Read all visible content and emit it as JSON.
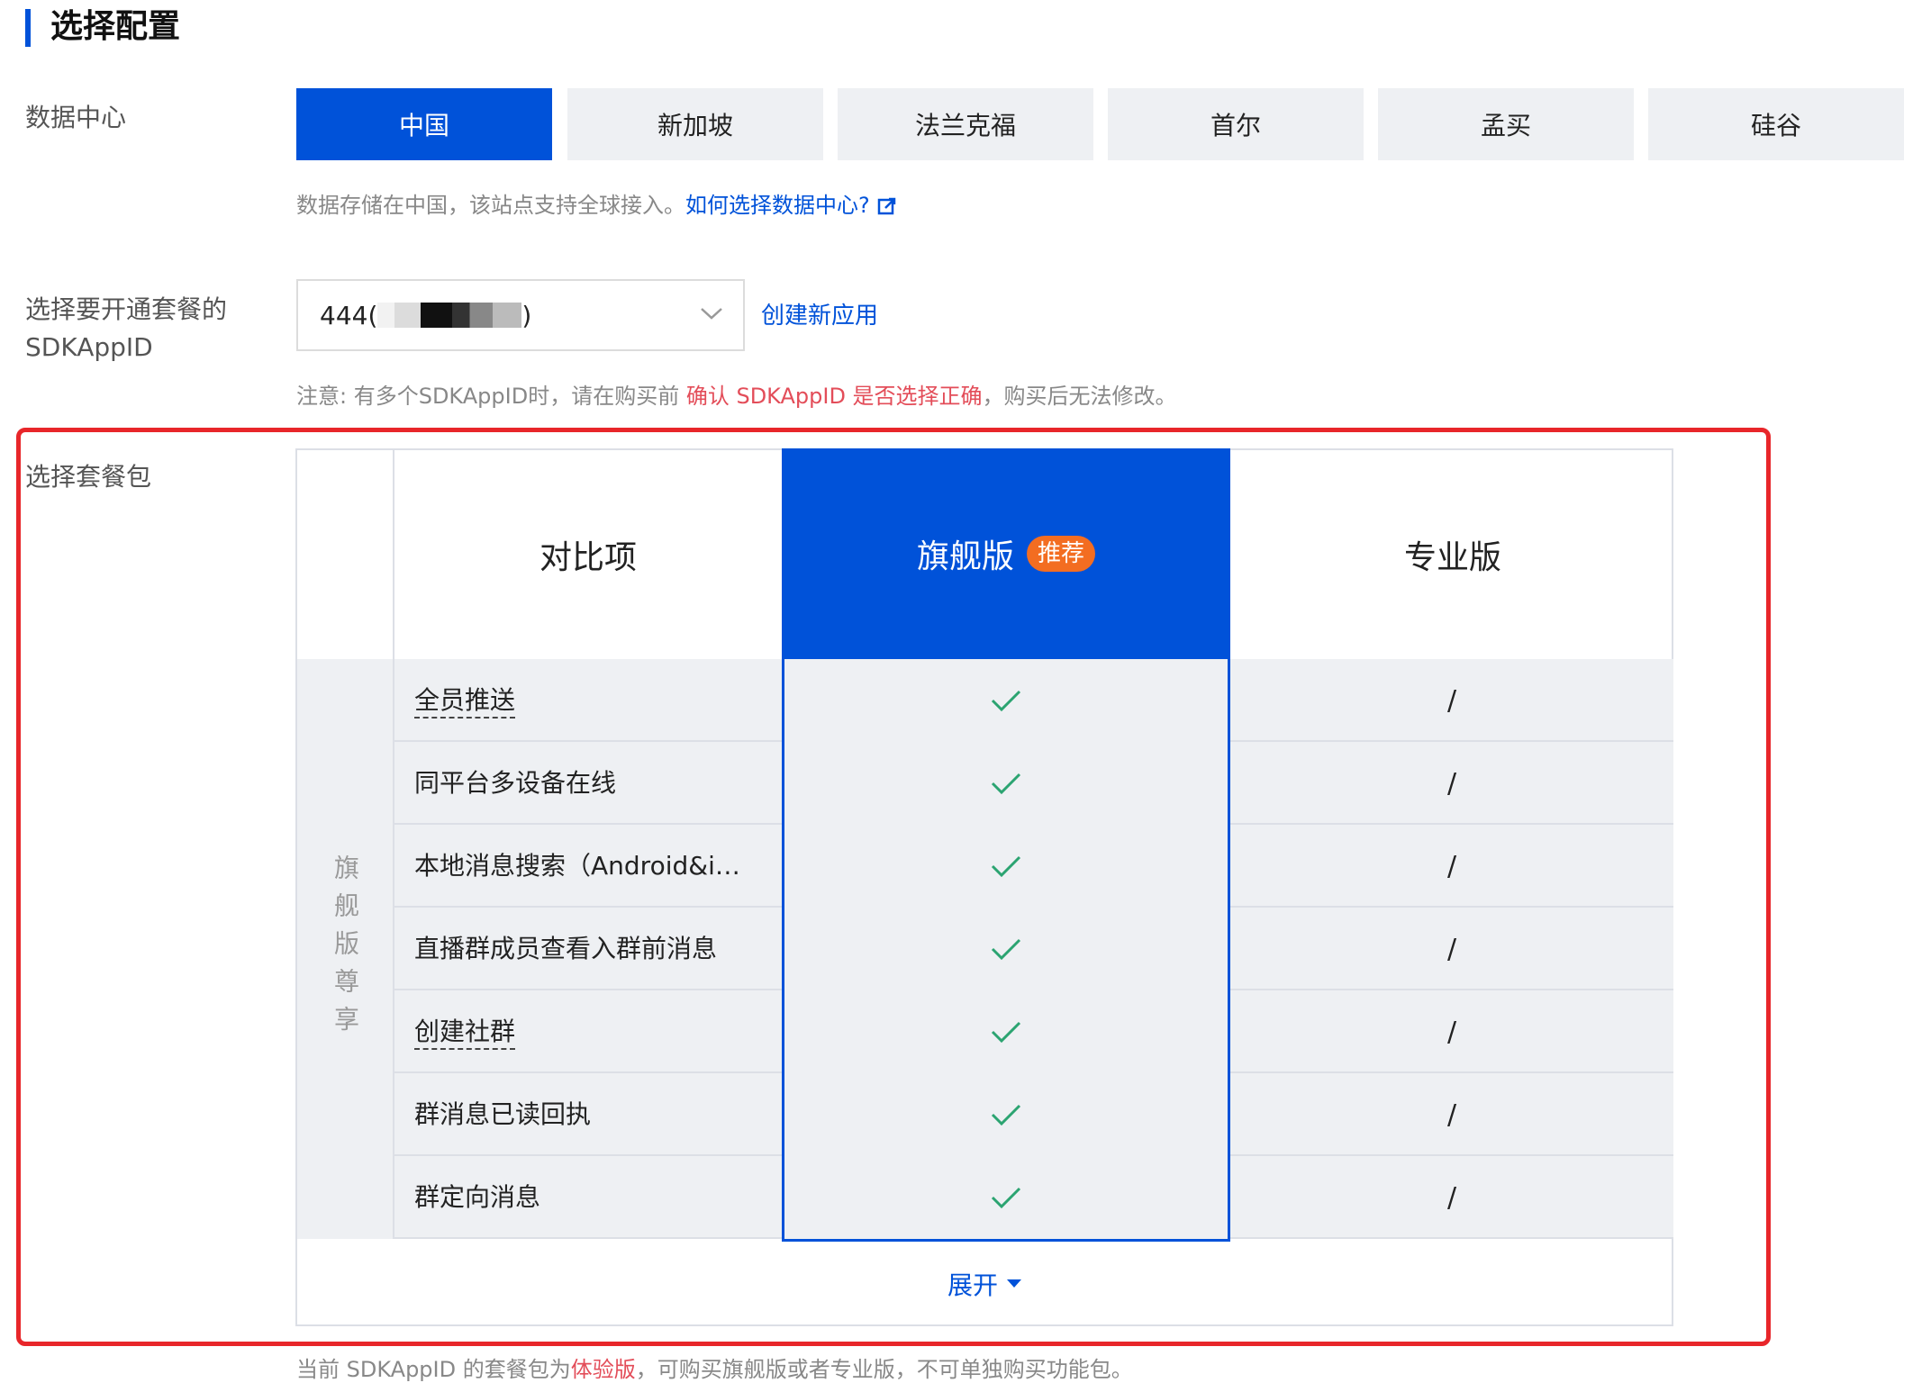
{
  "section": {
    "title": "选择配置"
  },
  "data_center": {
    "label": "数据中心",
    "options": [
      "中国",
      "新加坡",
      "法兰克福",
      "首尔",
      "孟买",
      "硅谷"
    ],
    "selected": "中国",
    "hint_text": "数据存储在中国，该站点支持全球接入。",
    "hint_link": "如何选择数据中心?"
  },
  "sdkappid": {
    "label_line1": "选择要开通套餐的",
    "label_line2": "SDKAppID",
    "value_prefix": "444(",
    "value_suffix": ")",
    "create_link": "创建新应用",
    "note_prefix": "注意: 有多个SDKAppID时，请在购买前 ",
    "note_emphasis": "确认 SDKAppID 是否选择正确",
    "note_suffix": "，购买后无法修改。"
  },
  "package": {
    "label": "选择套餐包",
    "compare_header": "对比项",
    "flagship_header": "旗舰版",
    "recommend_badge": "推荐",
    "pro_header": "专业版",
    "group_label": "旗舰版尊享",
    "rows": [
      {
        "name": "全员推送",
        "flagship": "check",
        "pro": "/",
        "dashed": true
      },
      {
        "name": "同平台多设备在线",
        "flagship": "check",
        "pro": "/",
        "dashed": false
      },
      {
        "name": "本地消息搜索（Android&i…",
        "flagship": "check",
        "pro": "/",
        "dashed": false
      },
      {
        "name": "直播群成员查看入群前消息",
        "flagship": "check",
        "pro": "/",
        "dashed": false
      },
      {
        "name": "创建社群",
        "flagship": "check",
        "pro": "/",
        "dashed": true
      },
      {
        "name": "群消息已读回执",
        "flagship": "check",
        "pro": "/",
        "dashed": false
      },
      {
        "name": "群定向消息",
        "flagship": "check",
        "pro": "/",
        "dashed": false
      }
    ],
    "expand_label": "展开",
    "footer_prefix": "当前 SDKAppID 的套餐包为",
    "footer_emphasis": "体验版",
    "footer_suffix": "，可购买旗舰版或者专业版，不可单独购买功能包。"
  },
  "colors": {
    "primary": "#0052d9",
    "danger": "#e34d59",
    "badge": "#f36d21",
    "check": "#2ba471",
    "frame": "#e8262a"
  }
}
